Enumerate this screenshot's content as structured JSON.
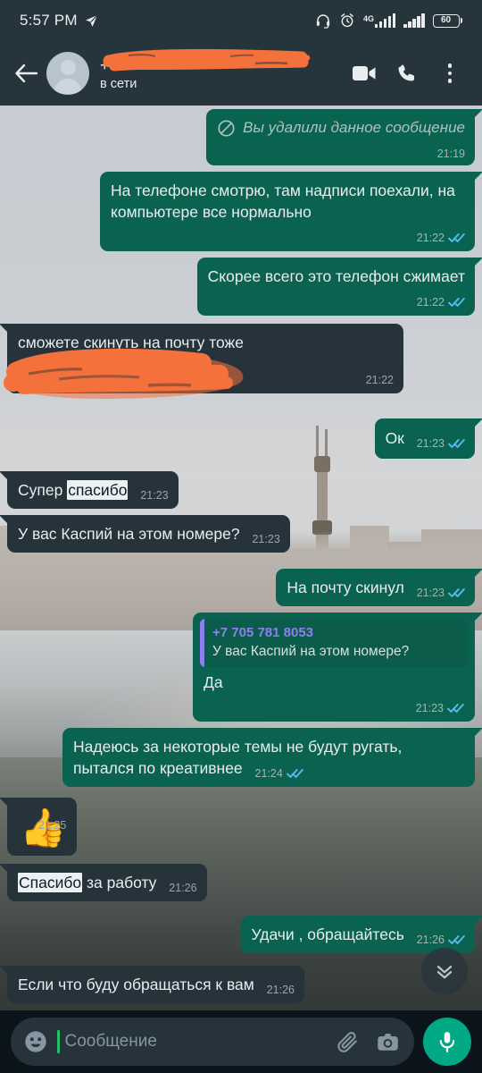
{
  "statusbar": {
    "time": "5:57 PM",
    "location_icon": "location-arrow-icon",
    "headset_icon": "headset-icon",
    "alarm_icon": "alarm-clock-icon",
    "network_label": "4G",
    "signal_icon": "signal-bars-icon",
    "signal2_icon": "signal-bars-secondary-icon",
    "battery_icon": "battery-icon",
    "battery_level": "60"
  },
  "header": {
    "back_icon": "back-arrow-icon",
    "avatar_icon": "default-contact-avatar",
    "contact_name": "+7 ",
    "contact_name_redacted": true,
    "status": "в сети",
    "video_call_icon": "video-call-icon",
    "voice_call_icon": "phone-call-icon",
    "overflow_icon": "more-options-icon"
  },
  "chat": {
    "scroll_down_icon": "double-chevron-down-icon",
    "messages": [
      {
        "id": "m1",
        "dir": "out",
        "type": "deleted",
        "text": "Вы удалили данное сообщение",
        "time": "21:19",
        "ticks": false,
        "deleted_icon": "blocked-circle-icon"
      },
      {
        "id": "m2",
        "dir": "out",
        "type": "text",
        "text": "На телефоне смотрю, там надписи поехали, на компьютере все нормально",
        "time": "21:22",
        "ticks": true
      },
      {
        "id": "m3",
        "dir": "out",
        "type": "text",
        "text": "Скорее всего это телефон сжимает",
        "time": "21:22",
        "ticks": true
      },
      {
        "id": "m4",
        "dir": "in",
        "type": "text",
        "text": "сможете скинуть на почту тоже",
        "time": "21:22",
        "ticks": false,
        "redacted": true
      },
      {
        "id": "m5",
        "dir": "out",
        "type": "text",
        "text": "Ок",
        "time": "21:23",
        "ticks": true
      },
      {
        "id": "m6",
        "dir": "in",
        "type": "highlight",
        "text_before": "Супер ",
        "text_highlight": "спасибо",
        "text_after": "",
        "time": "21:23",
        "ticks": false
      },
      {
        "id": "m7",
        "dir": "in",
        "type": "text",
        "text": "У вас Каспий на этом номере?",
        "time": "21:23",
        "ticks": false
      },
      {
        "id": "m8",
        "dir": "out",
        "type": "text",
        "text": "На почту скинул",
        "time": "21:23",
        "ticks": true
      },
      {
        "id": "m9",
        "dir": "out",
        "type": "reply",
        "quote_name": "+7 705 781 8053",
        "quote_text": "У вас Каспий на этом номере?",
        "text": "Да",
        "time": "21:23",
        "ticks": true
      },
      {
        "id": "m10",
        "dir": "out",
        "type": "text",
        "text": "Надеюсь за некоторые темы не будут ругать, пытался по креативнее",
        "time": "21:24",
        "ticks": true
      },
      {
        "id": "m11",
        "dir": "in",
        "type": "emoji",
        "text": "👍",
        "time": "21:25",
        "ticks": false
      },
      {
        "id": "m12",
        "dir": "in",
        "type": "highlight",
        "text_before": "",
        "text_highlight": "Спасибо",
        "text_after": " за работу",
        "time": "21:26",
        "ticks": false
      },
      {
        "id": "m13",
        "dir": "out",
        "type": "text",
        "text": "Удачи , обращайтесь",
        "time": "21:26",
        "ticks": true
      },
      {
        "id": "m14",
        "dir": "in",
        "type": "text",
        "text": "Если что буду обращаться к вам",
        "time": "21:26",
        "ticks": false
      }
    ]
  },
  "composer": {
    "emoji_icon": "emoji-smiley-icon",
    "placeholder": "Сообщение",
    "value": "",
    "attach_icon": "paperclip-icon",
    "camera_icon": "camera-icon",
    "mic_icon": "microphone-icon"
  },
  "colors": {
    "outgoing_bubble": "#0a6351",
    "incoming_bubble": "#26333b",
    "header_bg": "#26343c",
    "accent_green": "#00a884",
    "tick_blue": "#53bdeb",
    "quote_accent": "#8d7ff0",
    "redaction_orange": "#f4713c",
    "selection_highlight": "#eaf0f4"
  }
}
